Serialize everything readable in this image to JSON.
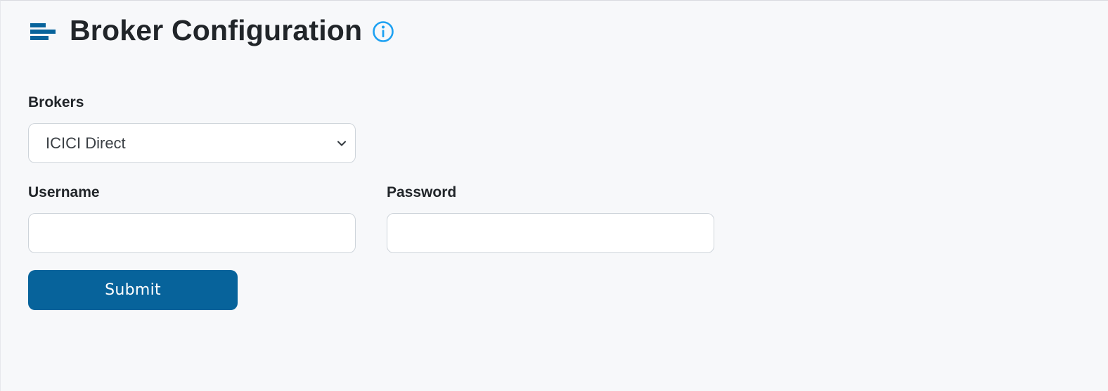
{
  "header": {
    "menu_icon": "menu-bars-icon",
    "title": "Broker Configuration",
    "info_icon": "info-circle-icon"
  },
  "colors": {
    "accent": "#07639b",
    "info": "#1da1f2",
    "background": "#f7f8fa"
  },
  "form": {
    "brokers": {
      "label": "Brokers",
      "selected": "ICICI Direct",
      "icon": "chevron-down-icon"
    },
    "username": {
      "label": "Username",
      "value": ""
    },
    "password": {
      "label": "Password",
      "value": ""
    },
    "submit_label": "Submit"
  }
}
